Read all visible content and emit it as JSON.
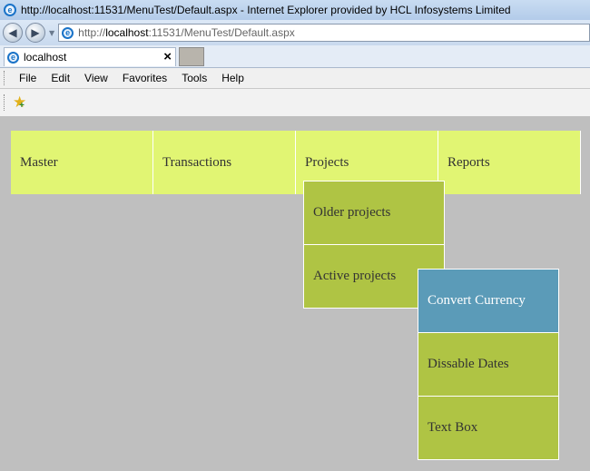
{
  "window": {
    "title": "http://localhost:11531/MenuTest/Default.aspx - Internet Explorer provided by HCL Infosystems Limited"
  },
  "address": {
    "prefix": "http://",
    "host": "localhost",
    "rest": ":11531/MenuTest/Default.aspx"
  },
  "tab": {
    "title": "localhost",
    "close_glyph": "×"
  },
  "menubar": {
    "items": [
      "File",
      "Edit",
      "View",
      "Favorites",
      "Tools",
      "Help"
    ]
  },
  "page_menu": {
    "top": [
      "Master",
      "Transactions",
      "Projects",
      "Reports"
    ],
    "projects_submenu": [
      "Older projects",
      "Active projects"
    ],
    "active_projects_submenu": [
      "Convert Currency",
      "Dissable Dates",
      "Text Box"
    ]
  },
  "colors": {
    "top_item": "#e1f573",
    "sub_item": "#afc444",
    "hover_item": "#5b9bb8",
    "page_bg": "#bfbfbf"
  },
  "icons": {
    "browser": "ie-logo-icon",
    "back": "back-arrow-icon",
    "forward": "forward-arrow-icon",
    "favorites": "add-favorites-star-icon"
  }
}
